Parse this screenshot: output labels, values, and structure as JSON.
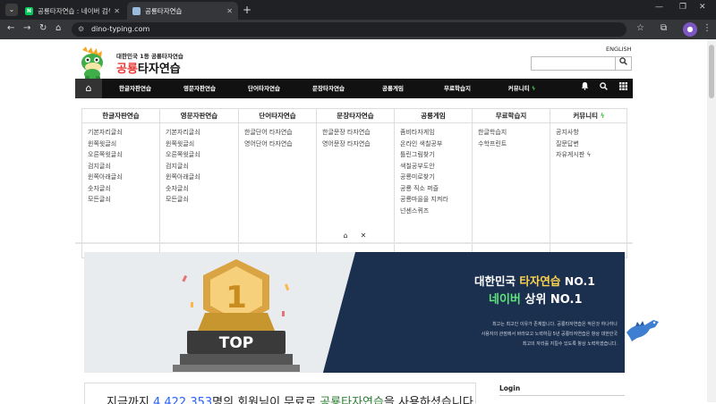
{
  "browser": {
    "tabs": [
      {
        "title": "공룡타자연습 : 네이버 검색",
        "favicon": "naver-favicon"
      },
      {
        "title": "공룡타자연습",
        "favicon": "dino-typing-favicon",
        "active": true
      }
    ],
    "url": "dino-typing.com"
  },
  "header": {
    "lang": "ENGLISH",
    "logo_sub": "대한민국 1등 공룡타자연습",
    "logo_title_prefix": "공룡",
    "logo_title_suffix": "타자연습"
  },
  "gnb": {
    "items": [
      "한글자판연습",
      "영문자판연습",
      "단어타자연습",
      "문장타자연습",
      "공룡게임",
      "무료학습지",
      "커뮤니티"
    ]
  },
  "mega_menu": {
    "columns": [
      {
        "title": "한글자판연습",
        "items": [
          "기본자리글쇠",
          "윈쪽윗글쇠",
          "오른쪽윗글쇠",
          "검지글쇠",
          "윈쪽아래글쇠",
          "숫자글쇠",
          "모든글쇠"
        ]
      },
      {
        "title": "영문자판연습",
        "items": [
          "기본자리글쇠",
          "윈쪽윗글쇠",
          "오른쪽윗글쇠",
          "검지글쇠",
          "윈쪽아래글쇠",
          "숫자글쇠",
          "모든글쇠"
        ]
      },
      {
        "title": "단어타자연습",
        "items": [
          "한글단어 타자연습",
          "영어단어 타자연습"
        ]
      },
      {
        "title": "문장타자연습",
        "items": [
          "한글문장 타자연습",
          "영어문장 타자연습"
        ]
      },
      {
        "title": "공룡게임",
        "items": [
          "좀비타자게임",
          "온라인 색칠공부",
          "틀린그림찾기",
          "색칠공부도안",
          "공룡미로찾기",
          "공룡 직소 퍼즐",
          "공룡마을을 지켜라",
          "넌센스퀴즈"
        ]
      },
      {
        "title": "무료학습지",
        "items": [
          "한글학습지",
          "수학프린트"
        ]
      },
      {
        "title": "커뮤니티",
        "items": [
          "공지사항",
          "질문답변",
          "자유게시판"
        ]
      }
    ]
  },
  "banner": {
    "badge_number": "1",
    "badge_text": "TOP",
    "title1_prefix": "대한민국 ",
    "title1_highlight": "타자연습",
    "title1_suffix": " NO.1",
    "title2_highlight": "네이버",
    "title2_suffix": " 상위 NO.1",
    "desc_lines": [
      "최고는 최고인 이유가 존재합니다. 공룡타자연습은 작은것 하나하나",
      "사용자의 관점에서 바라보고 노력하길 5년 공룡타자연습은 항상 대한민국",
      "최고의 자리를 지킬수 있도록 항상 노력하겠습니다."
    ]
  },
  "counter": {
    "prefix": "지금까지 ",
    "count": "4,422,353",
    "middle": "명의 회원님이 무료로 ",
    "brand": "공룡타자연습",
    "suffix": "을 사용하셨습니다."
  },
  "login": {
    "title": "Login"
  }
}
